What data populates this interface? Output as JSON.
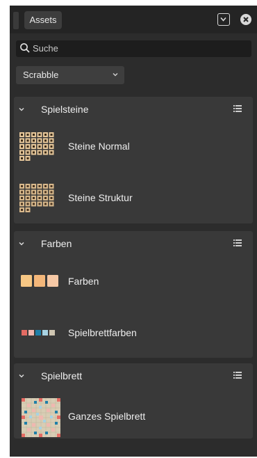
{
  "panel": {
    "tab_label": "Assets",
    "collapse_icon": "chevron-down-box-icon",
    "close_icon": "close-circle-icon"
  },
  "search": {
    "placeholder": "Suche",
    "icon": "search-icon"
  },
  "category": {
    "selected": "Scrabble"
  },
  "sections": [
    {
      "title": "Spielsteine",
      "items": [
        {
          "label": "Steine Normal",
          "icon": "tiles-thumbnail"
        },
        {
          "label": "Steine Struktur",
          "icon": "tiles-texture-thumbnail"
        }
      ]
    },
    {
      "title": "Farben",
      "items": [
        {
          "label": "Farben",
          "icon": "color-swatches-thumbnail"
        },
        {
          "label": "Spielbrettfarben",
          "icon": "board-color-swatches-thumbnail"
        }
      ]
    },
    {
      "title": "Spielbrett",
      "items": [
        {
          "label": "Ganzes Spielbrett",
          "icon": "board-thumbnail"
        }
      ]
    }
  ],
  "colors": {
    "panel_bg": "#2c2c2c",
    "section_bg": "#393939",
    "tile": "#e6c79a",
    "swatch_1": "#f7c784",
    "swatch_2": "#f4b77a",
    "swatch_3": "#f6c8a5",
    "board_red": "#e46b63",
    "board_pink": "#f0b8b0",
    "board_blue": "#1f7fa8",
    "board_lightblue": "#a7d3e3",
    "board_beige": "#cfc6b2"
  }
}
